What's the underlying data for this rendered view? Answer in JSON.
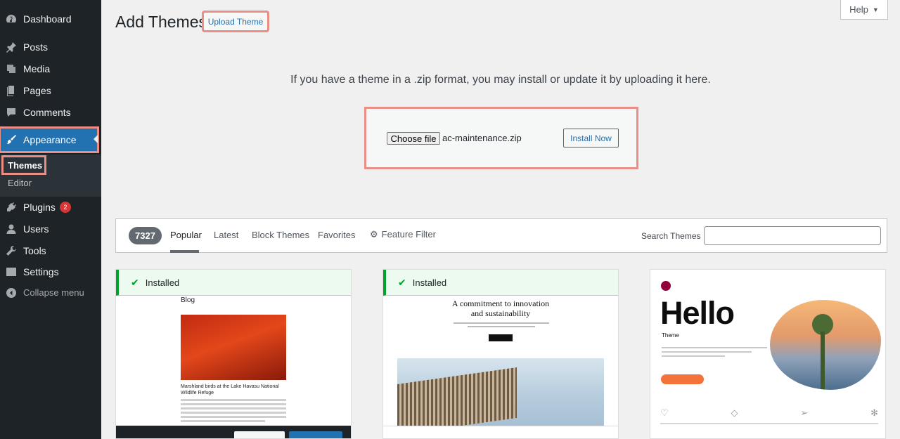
{
  "sidebar": {
    "items": [
      {
        "label": "Dashboard",
        "icon": "dashboard-icon"
      },
      {
        "label": "Posts",
        "icon": "pin-icon"
      },
      {
        "label": "Media",
        "icon": "media-icon"
      },
      {
        "label": "Pages",
        "icon": "pages-icon"
      },
      {
        "label": "Comments",
        "icon": "comment-icon"
      },
      {
        "label": "Appearance",
        "icon": "paintbrush-icon"
      },
      {
        "label": "Plugins",
        "icon": "plugin-icon",
        "badge": "2"
      },
      {
        "label": "Users",
        "icon": "user-icon"
      },
      {
        "label": "Tools",
        "icon": "wrench-icon"
      },
      {
        "label": "Settings",
        "icon": "settings-icon"
      }
    ],
    "submenu": {
      "themes": "Themes",
      "editor": "Editor"
    },
    "collapse_label": "Collapse menu"
  },
  "header": {
    "title": "Add Themes",
    "upload_button": "Upload Theme",
    "help_button": "Help"
  },
  "upload": {
    "instructions": "If you have a theme in a .zip format, you may install or update it by uploading it here.",
    "choose_file_label": "Choose file",
    "file_name": "ac-maintenance.zip",
    "install_button": "Install Now"
  },
  "filter_bar": {
    "count": "7327",
    "tabs": [
      "Popular",
      "Latest",
      "Block Themes",
      "Favorites"
    ],
    "feature_filter": "Feature Filter",
    "search_label": "Search Themes",
    "search_value": ""
  },
  "themes": [
    {
      "installed_label": "Installed",
      "preview_heading": "Blog",
      "preview_caption": "Marshland birds at the Lake Havasu National Wildlife Refuge"
    },
    {
      "installed_label": "Installed",
      "preview_heading": "A commitment to innovation and sustainability"
    },
    {
      "preview_heading": "Hello",
      "preview_sub": "Theme"
    }
  ],
  "colors": {
    "sidebar_bg": "#1d2327",
    "accent": "#2271b1",
    "installed_green": "#00a32a",
    "highlight": "#ea8f86"
  }
}
